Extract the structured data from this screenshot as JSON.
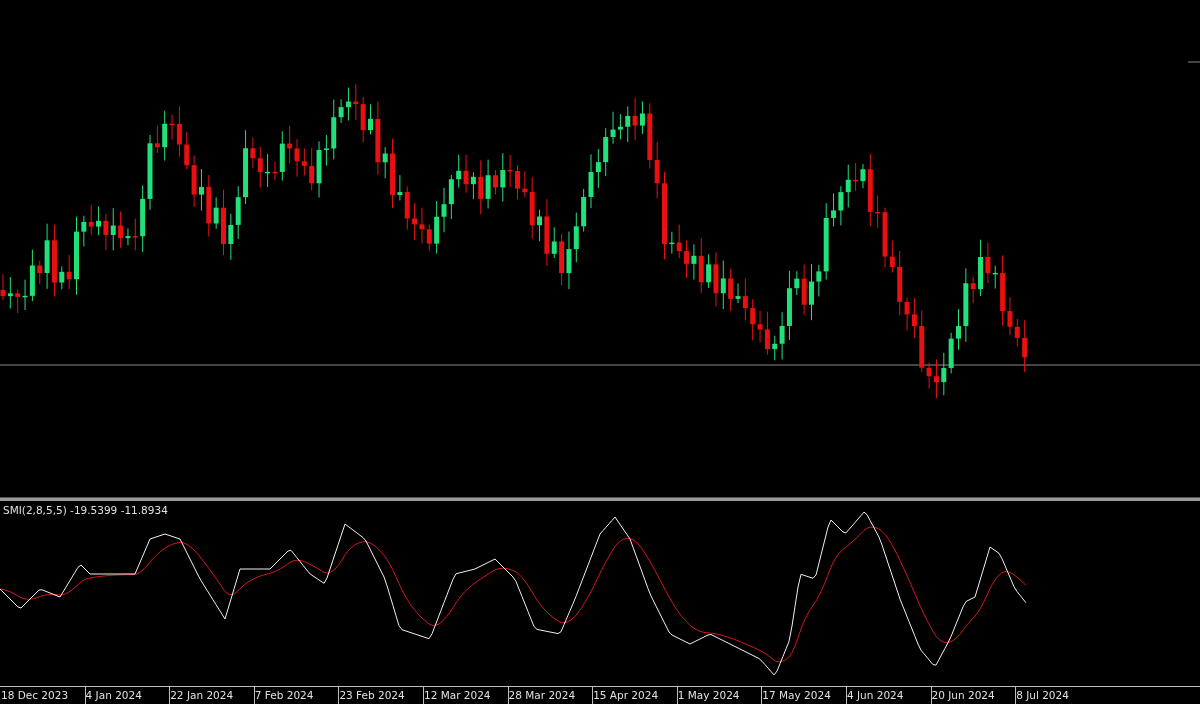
{
  "indicator": {
    "label": "SMI(2,8,5,5) -19.5399 -11.8934"
  },
  "time_axis": {
    "labels": [
      "18 Dec 2023",
      "4 Jan 2024",
      "22 Jan 2024",
      "7 Feb 2024",
      "23 Feb 2024",
      "12 Mar 2024",
      "28 Mar 2024",
      "15 Apr 2024",
      "1 May 2024",
      "17 May 2024",
      "4 Jun 2024",
      "20 Jun 2024",
      "8 Jul 2024"
    ]
  }
}
